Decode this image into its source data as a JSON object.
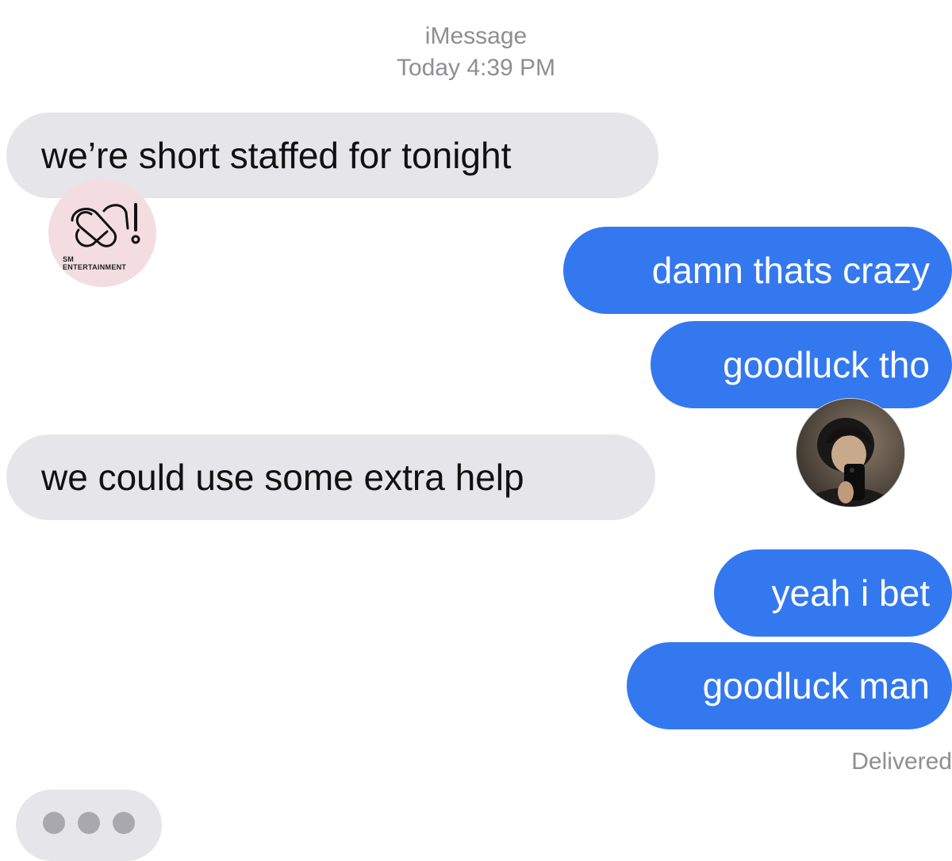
{
  "header": {
    "service": "iMessage",
    "timestamp": "Today 4:39 PM"
  },
  "messages": [
    {
      "direction": "incoming",
      "text": "we’re short staffed for tonight"
    },
    {
      "direction": "outgoing",
      "text": "damn thats crazy"
    },
    {
      "direction": "outgoing",
      "text": "goodluck tho"
    },
    {
      "direction": "incoming",
      "text": "we could use some extra help"
    },
    {
      "direction": "outgoing",
      "text": "yeah i bet"
    },
    {
      "direction": "outgoing",
      "text": "goodluck man"
    }
  ],
  "status": "Delivered",
  "typing_indicator": {
    "dots": 3
  },
  "overlays": {
    "logo": {
      "line1": "SM",
      "line2": "ENTERTAINMENT",
      "icon": "sm-logo-icon"
    },
    "avatar": {
      "icon": "profile-photo"
    }
  },
  "colors": {
    "incoming_bubble": "#e5e5ea",
    "outgoing_bubble": "#3478f0",
    "meta_text": "#8e8e93",
    "logo_background": "#f3dde0"
  }
}
